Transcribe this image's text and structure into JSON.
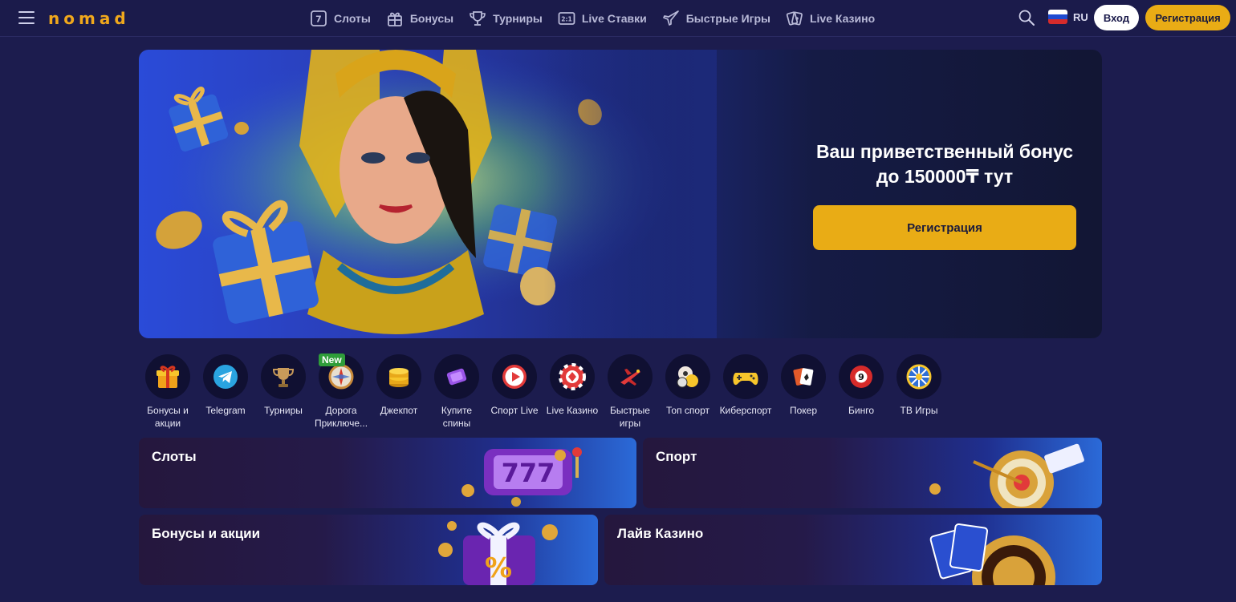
{
  "header": {
    "logo": "nomad",
    "nav": [
      {
        "label": "Слоты",
        "icon": "slot-machine-icon"
      },
      {
        "label": "Бонусы",
        "icon": "gift-icon"
      },
      {
        "label": "Турниры",
        "icon": "trophy-icon"
      },
      {
        "label": "Live Ставки",
        "icon": "scoreboard-icon"
      },
      {
        "label": "Быстрые Игры",
        "icon": "plane-icon"
      },
      {
        "label": "Live Казино",
        "icon": "cards-icon"
      }
    ],
    "language": "RU",
    "login_label": "Вход",
    "register_label": "Регистрация"
  },
  "hero": {
    "title_line1": "Ваш приветственный бонус",
    "title_line2": "до 150000₸ тут",
    "button_label": "Регистрация"
  },
  "categories": [
    {
      "label": "Бонусы и акции",
      "icon": "gift-box-icon"
    },
    {
      "label": "Telegram",
      "icon": "telegram-icon"
    },
    {
      "label": "Турниры",
      "icon": "trophy-icon"
    },
    {
      "label": "Дорога Приключе...",
      "icon": "compass-icon",
      "badge": "New"
    },
    {
      "label": "Джекпот",
      "icon": "coins-icon"
    },
    {
      "label": "Купите спины",
      "icon": "purple-ticket-icon"
    },
    {
      "label": "Спорт Live",
      "icon": "play-icon"
    },
    {
      "label": "Live Казино",
      "icon": "casino-chip-icon"
    },
    {
      "label": "Быстрые игры",
      "icon": "red-plane-icon"
    },
    {
      "label": "Топ спорт",
      "icon": "sport-balls-icon"
    },
    {
      "label": "Киберспорт",
      "icon": "gamepad-icon"
    },
    {
      "label": "Покер",
      "icon": "poker-cards-icon"
    },
    {
      "label": "Бинго",
      "icon": "bingo-ball-icon"
    },
    {
      "label": "ТВ Игры",
      "icon": "wheel-icon"
    }
  ],
  "tiles": [
    {
      "label": "Слоты"
    },
    {
      "label": "Спорт"
    },
    {
      "label": "Бонусы и акции"
    },
    {
      "label": "Лайв Казино"
    }
  ],
  "colors": {
    "background": "#1c1c4e",
    "accent": "#e9ac15",
    "nav_text": "#b9bad8"
  }
}
